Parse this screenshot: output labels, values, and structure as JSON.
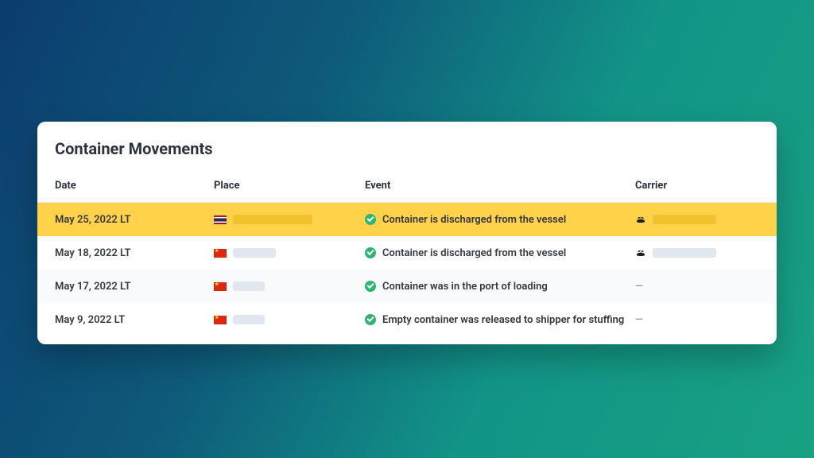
{
  "title": "Container Movements",
  "columns": {
    "date": "Date",
    "place": "Place",
    "event": "Event",
    "carrier": "Carrier"
  },
  "rows": [
    {
      "date": "May 25, 2022  LT",
      "place_flag": "th",
      "event": "Container is discharged from the vessel",
      "has_carrier_icon": true,
      "highlight": true
    },
    {
      "date": "May 18, 2022 LT",
      "place_flag": "cn",
      "event": "Container is discharged from the vessel",
      "has_carrier_icon": true,
      "highlight": false
    },
    {
      "date": "May 17, 2022 LT",
      "place_flag": "cn",
      "event": "Container was in the port of loading",
      "has_carrier_icon": false,
      "highlight": false
    },
    {
      "date": "May 9, 2022 LT",
      "place_flag": "cn",
      "event": "Empty container was released to shipper for stuffing",
      "has_carrier_icon": false,
      "highlight": false
    }
  ]
}
